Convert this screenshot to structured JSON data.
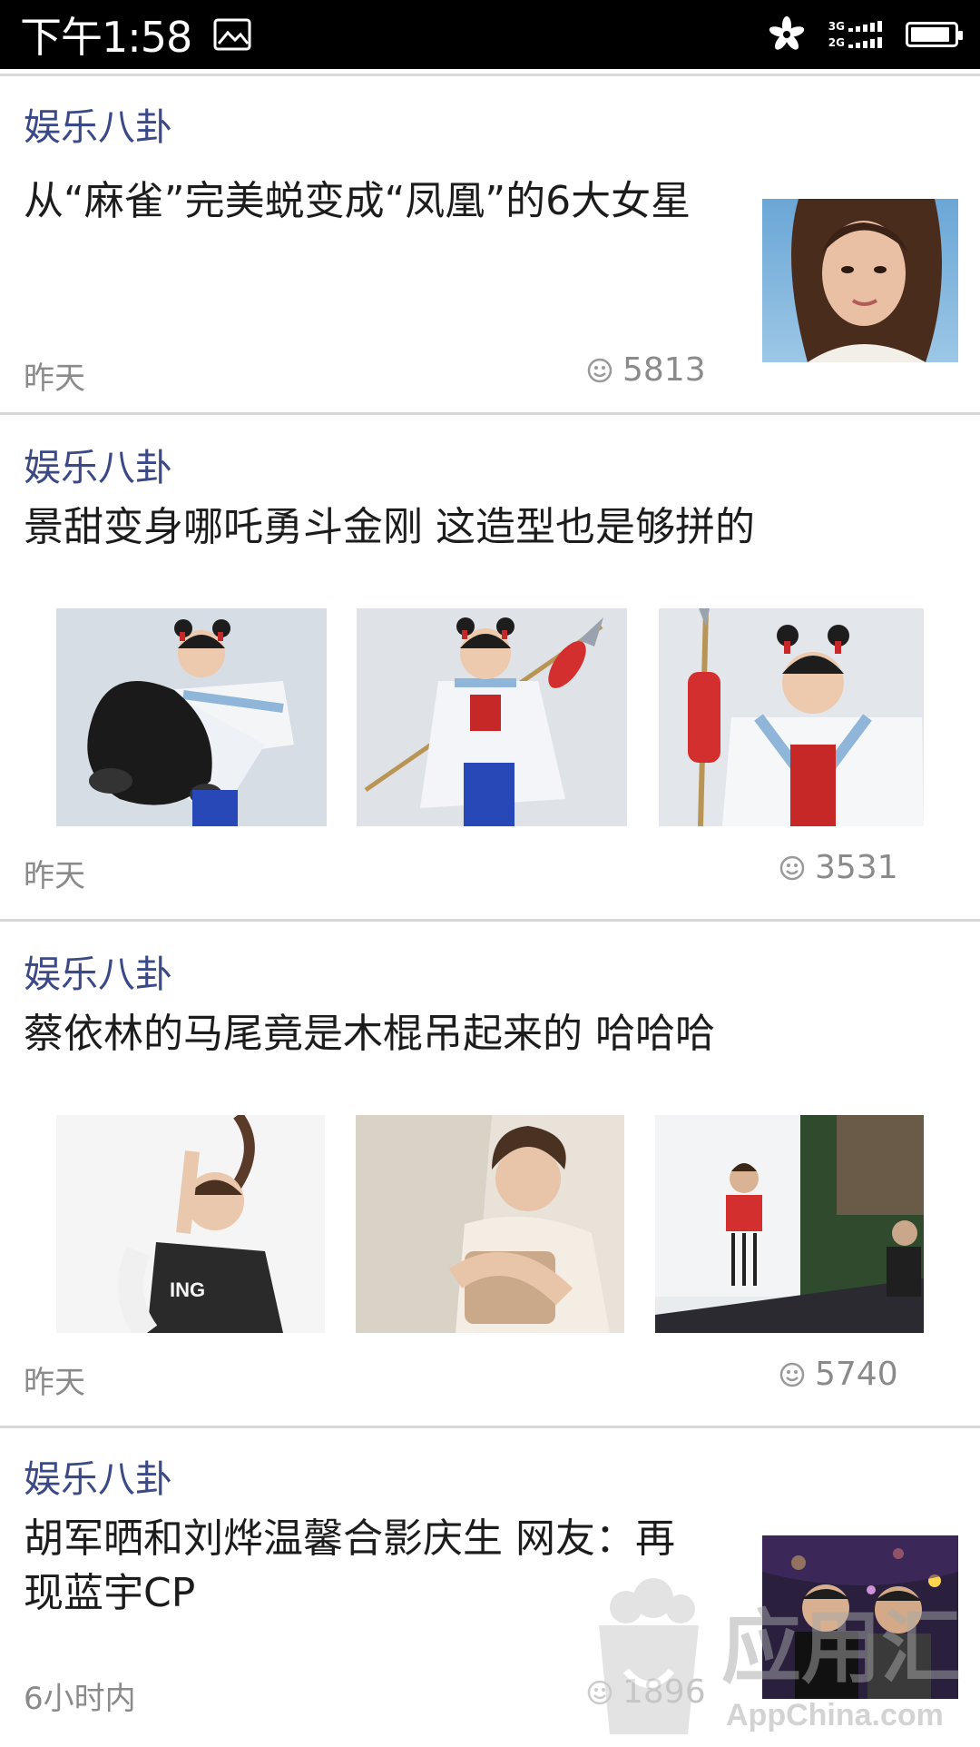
{
  "status_bar": {
    "time": "下午1:58",
    "gallery_icon": "gallery-icon",
    "flower_icon": "flower-icon",
    "network_top": "3G",
    "network_bottom": "2G",
    "battery_level": 0.8
  },
  "articles": [
    {
      "category": "娱乐八卦",
      "title": "从“麻雀”完美蜕变成“凤凰”的6大女星",
      "time": "昨天",
      "views": "5813",
      "image_count": 1
    },
    {
      "category": "娱乐八卦",
      "title": "景甜变身哪吒勇斗金刚 这造型也是够拼的",
      "time": "昨天",
      "views": "3531",
      "image_count": 3
    },
    {
      "category": "娱乐八卦",
      "title": "蔡依林的马尾竟是木棍吊起来的 哈哈哈",
      "time": "昨天",
      "views": "5740",
      "image_count": 3
    },
    {
      "category": "娱乐八卦",
      "title_line1": "胡军晒和刘烨温馨合影庆生 网友：再",
      "title_line2": "现蓝宇CP",
      "time": "6小时内",
      "views": "1896",
      "image_count": 1
    }
  ],
  "watermark": {
    "brand": "应用汇",
    "url": "AppChina.com"
  },
  "colors": {
    "category": "#3b4a86",
    "title": "#1c1c1c",
    "meta": "#8a8a8a",
    "divider": "#d6d6d6"
  }
}
